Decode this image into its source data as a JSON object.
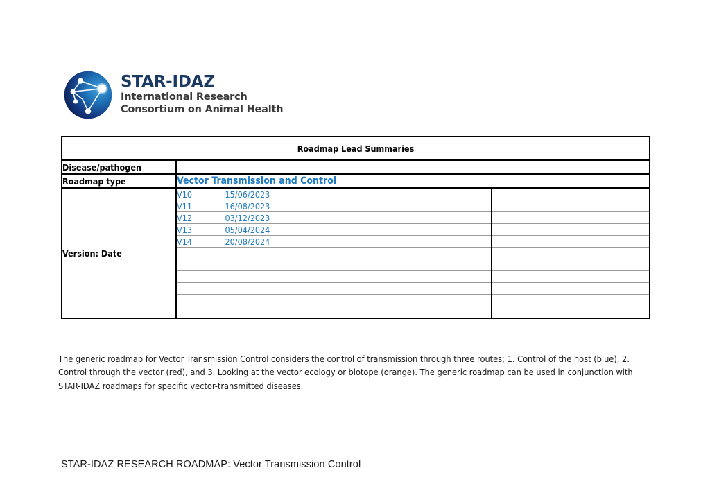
{
  "logo": {
    "icon": "star-network-sphere-icon",
    "title": "STAR-IDAZ",
    "subtitle_line1": "International Research",
    "subtitle_line2": "Consortium on Animal Health",
    "title_color": "#1b3a63",
    "subtitle_color": "#3a3a3a"
  },
  "table": {
    "title": "Roadmap Lead Summaries",
    "rows": {
      "disease_pathogen_label": "Disease/pathogen",
      "disease_pathogen_value": "",
      "roadmap_type_label": "Roadmap type",
      "roadmap_type_value": "Vector Transmission and Control",
      "version_label": "Version: Date"
    },
    "accent_color": "#1f7ac0",
    "versions": [
      {
        "version": "V10",
        "date": "15/06/2023",
        "col3": "",
        "col4": ""
      },
      {
        "version": "V11",
        "date": "16/08/2023",
        "col3": "",
        "col4": ""
      },
      {
        "version": "V12",
        "date": "03/12/2023",
        "col3": "",
        "col4": ""
      },
      {
        "version": "V13",
        "date": "05/04/2024",
        "col3": "",
        "col4": ""
      },
      {
        "version": "V14",
        "date": "20/08/2024",
        "col3": "",
        "col4": ""
      },
      {
        "version": "",
        "date": "",
        "col3": "",
        "col4": ""
      },
      {
        "version": "",
        "date": "",
        "col3": "",
        "col4": ""
      },
      {
        "version": "",
        "date": "",
        "col3": "",
        "col4": ""
      },
      {
        "version": "",
        "date": "",
        "col3": "",
        "col4": ""
      },
      {
        "version": "",
        "date": "",
        "col3": "",
        "col4": ""
      },
      {
        "version": "",
        "date": "",
        "col3": "",
        "col4": ""
      }
    ]
  },
  "body": {
    "paragraph": "The generic roadmap for Vector Transmission Control considers the control of transmission through three routes; 1. Control of the host (blue), 2. Control through the vector (red), and 3. Looking at the vector ecology or biotope (orange). The generic roadmap can be used in conjunction with STAR-IDAZ roadmaps for specific vector-transmitted diseases."
  },
  "footer": {
    "text": "STAR-IDAZ RESEARCH ROADMAP: Vector Transmission Control"
  }
}
